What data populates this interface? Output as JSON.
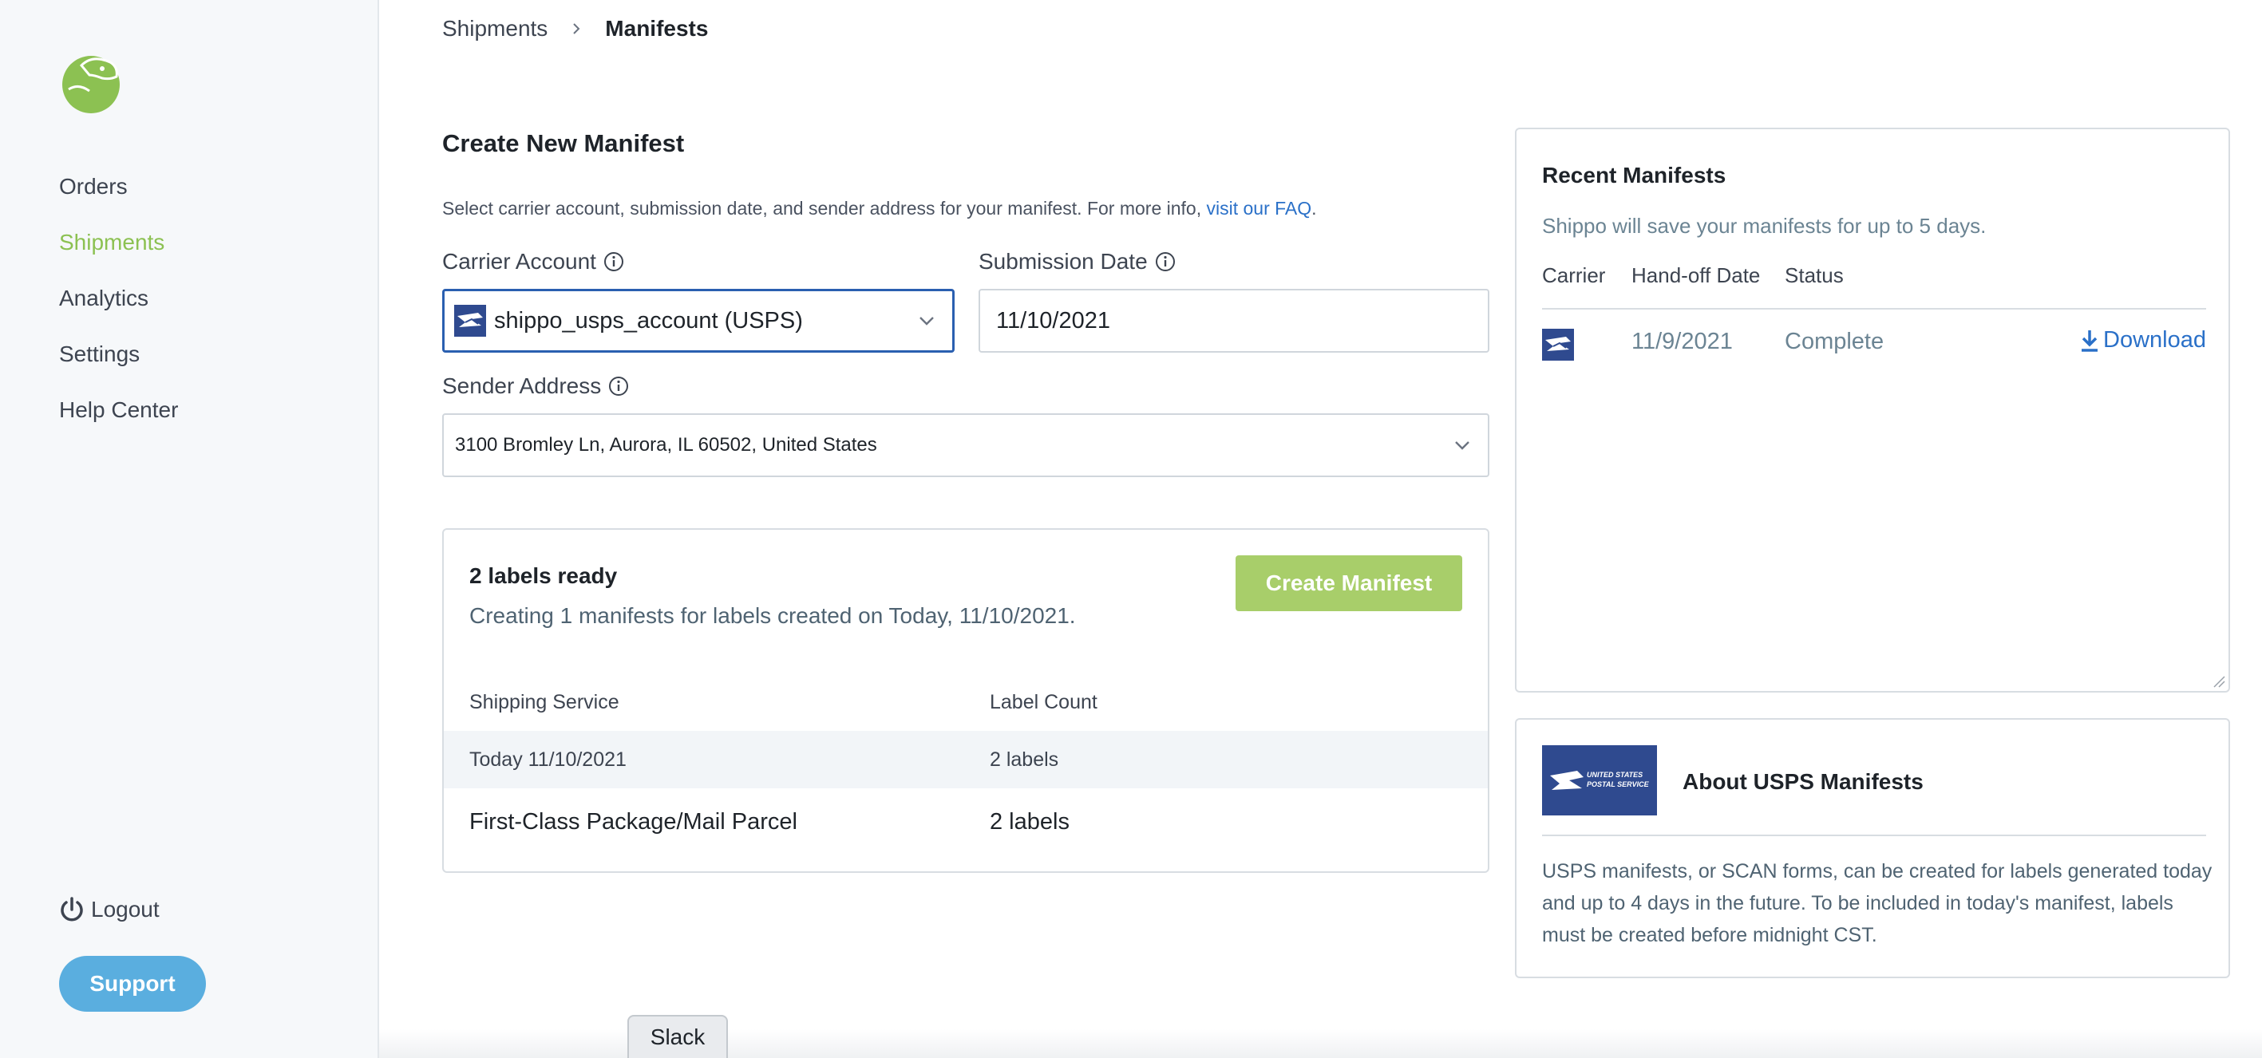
{
  "sidebar": {
    "logo": "shippo-logo",
    "items": [
      {
        "label": "Orders",
        "active": false
      },
      {
        "label": "Shipments",
        "active": true
      },
      {
        "label": "Analytics",
        "active": false
      },
      {
        "label": "Settings",
        "active": false
      },
      {
        "label": "Help Center",
        "active": false
      }
    ],
    "logout_label": "Logout",
    "support_label": "Support",
    "accent_color": "#8cc152"
  },
  "breadcrumb": {
    "parent": "Shipments",
    "current": "Manifests"
  },
  "create_form": {
    "title": "Create New Manifest",
    "description": "Select carrier account, submission date, and sender address for your manifest. For more info, ",
    "faq_link": "visit our FAQ",
    "description_end": ".",
    "carrier_label": "Carrier Account",
    "carrier_value": "shippo_usps_account (USPS)",
    "date_label": "Submission Date",
    "date_value": "11/10/2021",
    "sender_label": "Sender Address",
    "sender_value": "3100 Bromley Ln, Aurora, IL 60502, United States"
  },
  "ready_card": {
    "title": "2 labels ready",
    "subtitle": "Creating 1 manifests for labels created on Today, 11/10/2021.",
    "create_button": "Create Manifest",
    "headers": {
      "service": "Shipping Service",
      "count": "Label Count"
    },
    "group": {
      "service": "Today 11/10/2021",
      "count": "2 labels"
    },
    "rows": [
      {
        "service": "First-Class Package/Mail Parcel",
        "count": "2 labels"
      }
    ]
  },
  "recent": {
    "title": "Recent Manifests",
    "subtitle": "Shippo will save your manifests for up to 5 days.",
    "headers": {
      "carrier": "Carrier",
      "handoff": "Hand-off Date",
      "status": "Status"
    },
    "rows": [
      {
        "carrier_icon": "usps-eagle-icon",
        "handoff": "11/9/2021",
        "status": "Complete",
        "action": "Download"
      }
    ]
  },
  "about": {
    "title": "About USPS Manifests",
    "logo_text": "UNITED STATES POSTAL SERVICE",
    "text": "USPS manifests, or SCAN forms, can be created for labels generated today and up to 4 days in the future. To be included in today's manifest, labels must be created before midnight CST."
  },
  "slack_tab": "Slack",
  "colors": {
    "primary_button": "#a8ce6a",
    "support_button": "#5aaedf",
    "link": "#2a70c8",
    "usps_blue": "#2f4a8f"
  }
}
